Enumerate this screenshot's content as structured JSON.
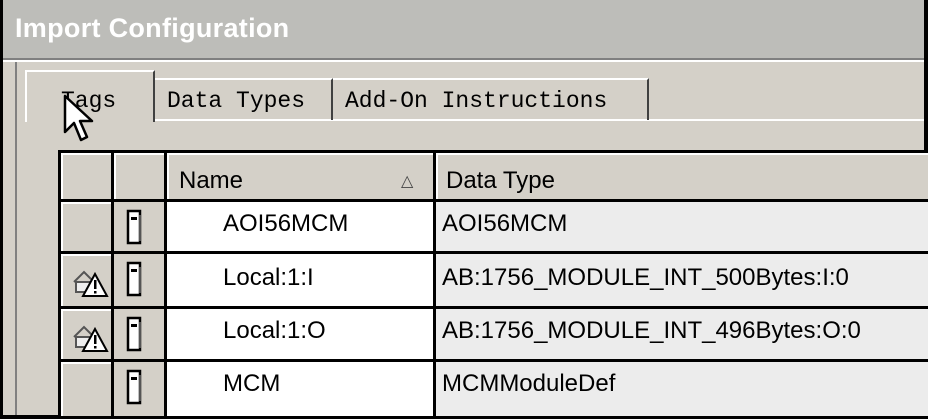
{
  "window": {
    "title": "Import Configuration"
  },
  "tabs": [
    {
      "label": "Tags",
      "active": true
    },
    {
      "label": "Data Types",
      "active": false
    },
    {
      "label": "Add-On Instructions",
      "active": false
    }
  ],
  "table": {
    "columns": [
      {
        "label": "",
        "name": "status"
      },
      {
        "label": "",
        "name": "icon"
      },
      {
        "label": "Name",
        "sort": "ascending",
        "sort_icon": "sort-ascending-icon"
      },
      {
        "label": "Data Type"
      }
    ],
    "rows": [
      {
        "name": "AOI56MCM",
        "data_type": "AOI56MCM",
        "status_icon": "",
        "row_icon": "module-icon"
      },
      {
        "name": "Local:1:I",
        "data_type": "AB:1756_MODULE_INT_500Bytes:I:0",
        "status_icon": "warning-icon",
        "row_icon": "module-icon"
      },
      {
        "name": "Local:1:O",
        "data_type": "AB:1756_MODULE_INT_496Bytes:O:0",
        "status_icon": "warning-icon",
        "row_icon": "module-icon"
      },
      {
        "name": "MCM",
        "data_type": "MCMModuleDef",
        "status_icon": "",
        "row_icon": "module-icon"
      }
    ]
  },
  "colors": {
    "window_bg": "#d4d0c8",
    "title_bar": "#bdbdb9",
    "cell_white": "#ffffff"
  }
}
